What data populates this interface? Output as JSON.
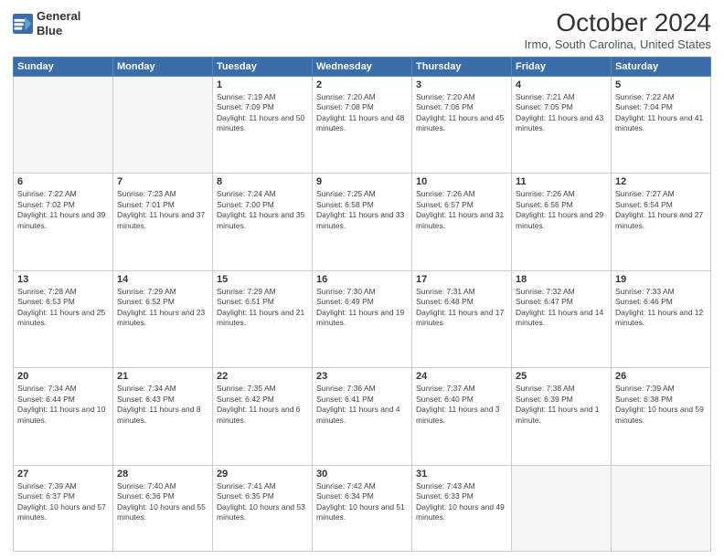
{
  "header": {
    "logo_line1": "General",
    "logo_line2": "Blue",
    "month": "October 2024",
    "location": "Irmo, South Carolina, United States"
  },
  "weekdays": [
    "Sunday",
    "Monday",
    "Tuesday",
    "Wednesday",
    "Thursday",
    "Friday",
    "Saturday"
  ],
  "weeks": [
    [
      {
        "day": "",
        "info": ""
      },
      {
        "day": "",
        "info": ""
      },
      {
        "day": "1",
        "info": "Sunrise: 7:19 AM\nSunset: 7:09 PM\nDaylight: 11 hours and 50 minutes."
      },
      {
        "day": "2",
        "info": "Sunrise: 7:20 AM\nSunset: 7:08 PM\nDaylight: 11 hours and 48 minutes."
      },
      {
        "day": "3",
        "info": "Sunrise: 7:20 AM\nSunset: 7:06 PM\nDaylight: 11 hours and 45 minutes."
      },
      {
        "day": "4",
        "info": "Sunrise: 7:21 AM\nSunset: 7:05 PM\nDaylight: 11 hours and 43 minutes."
      },
      {
        "day": "5",
        "info": "Sunrise: 7:22 AM\nSunset: 7:04 PM\nDaylight: 11 hours and 41 minutes."
      }
    ],
    [
      {
        "day": "6",
        "info": "Sunrise: 7:22 AM\nSunset: 7:02 PM\nDaylight: 11 hours and 39 minutes."
      },
      {
        "day": "7",
        "info": "Sunrise: 7:23 AM\nSunset: 7:01 PM\nDaylight: 11 hours and 37 minutes."
      },
      {
        "day": "8",
        "info": "Sunrise: 7:24 AM\nSunset: 7:00 PM\nDaylight: 11 hours and 35 minutes."
      },
      {
        "day": "9",
        "info": "Sunrise: 7:25 AM\nSunset: 6:58 PM\nDaylight: 11 hours and 33 minutes."
      },
      {
        "day": "10",
        "info": "Sunrise: 7:26 AM\nSunset: 6:57 PM\nDaylight: 11 hours and 31 minutes."
      },
      {
        "day": "11",
        "info": "Sunrise: 7:26 AM\nSunset: 6:56 PM\nDaylight: 11 hours and 29 minutes."
      },
      {
        "day": "12",
        "info": "Sunrise: 7:27 AM\nSunset: 6:54 PM\nDaylight: 11 hours and 27 minutes."
      }
    ],
    [
      {
        "day": "13",
        "info": "Sunrise: 7:28 AM\nSunset: 6:53 PM\nDaylight: 11 hours and 25 minutes."
      },
      {
        "day": "14",
        "info": "Sunrise: 7:29 AM\nSunset: 6:52 PM\nDaylight: 11 hours and 23 minutes."
      },
      {
        "day": "15",
        "info": "Sunrise: 7:29 AM\nSunset: 6:51 PM\nDaylight: 11 hours and 21 minutes."
      },
      {
        "day": "16",
        "info": "Sunrise: 7:30 AM\nSunset: 6:49 PM\nDaylight: 11 hours and 19 minutes."
      },
      {
        "day": "17",
        "info": "Sunrise: 7:31 AM\nSunset: 6:48 PM\nDaylight: 11 hours and 17 minutes."
      },
      {
        "day": "18",
        "info": "Sunrise: 7:32 AM\nSunset: 6:47 PM\nDaylight: 11 hours and 14 minutes."
      },
      {
        "day": "19",
        "info": "Sunrise: 7:33 AM\nSunset: 6:46 PM\nDaylight: 11 hours and 12 minutes."
      }
    ],
    [
      {
        "day": "20",
        "info": "Sunrise: 7:34 AM\nSunset: 6:44 PM\nDaylight: 11 hours and 10 minutes."
      },
      {
        "day": "21",
        "info": "Sunrise: 7:34 AM\nSunset: 6:43 PM\nDaylight: 11 hours and 8 minutes."
      },
      {
        "day": "22",
        "info": "Sunrise: 7:35 AM\nSunset: 6:42 PM\nDaylight: 11 hours and 6 minutes."
      },
      {
        "day": "23",
        "info": "Sunrise: 7:36 AM\nSunset: 6:41 PM\nDaylight: 11 hours and 4 minutes."
      },
      {
        "day": "24",
        "info": "Sunrise: 7:37 AM\nSunset: 6:40 PM\nDaylight: 11 hours and 3 minutes."
      },
      {
        "day": "25",
        "info": "Sunrise: 7:38 AM\nSunset: 6:39 PM\nDaylight: 11 hours and 1 minute."
      },
      {
        "day": "26",
        "info": "Sunrise: 7:39 AM\nSunset: 6:38 PM\nDaylight: 10 hours and 59 minutes."
      }
    ],
    [
      {
        "day": "27",
        "info": "Sunrise: 7:39 AM\nSunset: 6:37 PM\nDaylight: 10 hours and 57 minutes."
      },
      {
        "day": "28",
        "info": "Sunrise: 7:40 AM\nSunset: 6:36 PM\nDaylight: 10 hours and 55 minutes."
      },
      {
        "day": "29",
        "info": "Sunrise: 7:41 AM\nSunset: 6:35 PM\nDaylight: 10 hours and 53 minutes."
      },
      {
        "day": "30",
        "info": "Sunrise: 7:42 AM\nSunset: 6:34 PM\nDaylight: 10 hours and 51 minutes."
      },
      {
        "day": "31",
        "info": "Sunrise: 7:43 AM\nSunset: 6:33 PM\nDaylight: 10 hours and 49 minutes."
      },
      {
        "day": "",
        "info": ""
      },
      {
        "day": "",
        "info": ""
      }
    ]
  ]
}
